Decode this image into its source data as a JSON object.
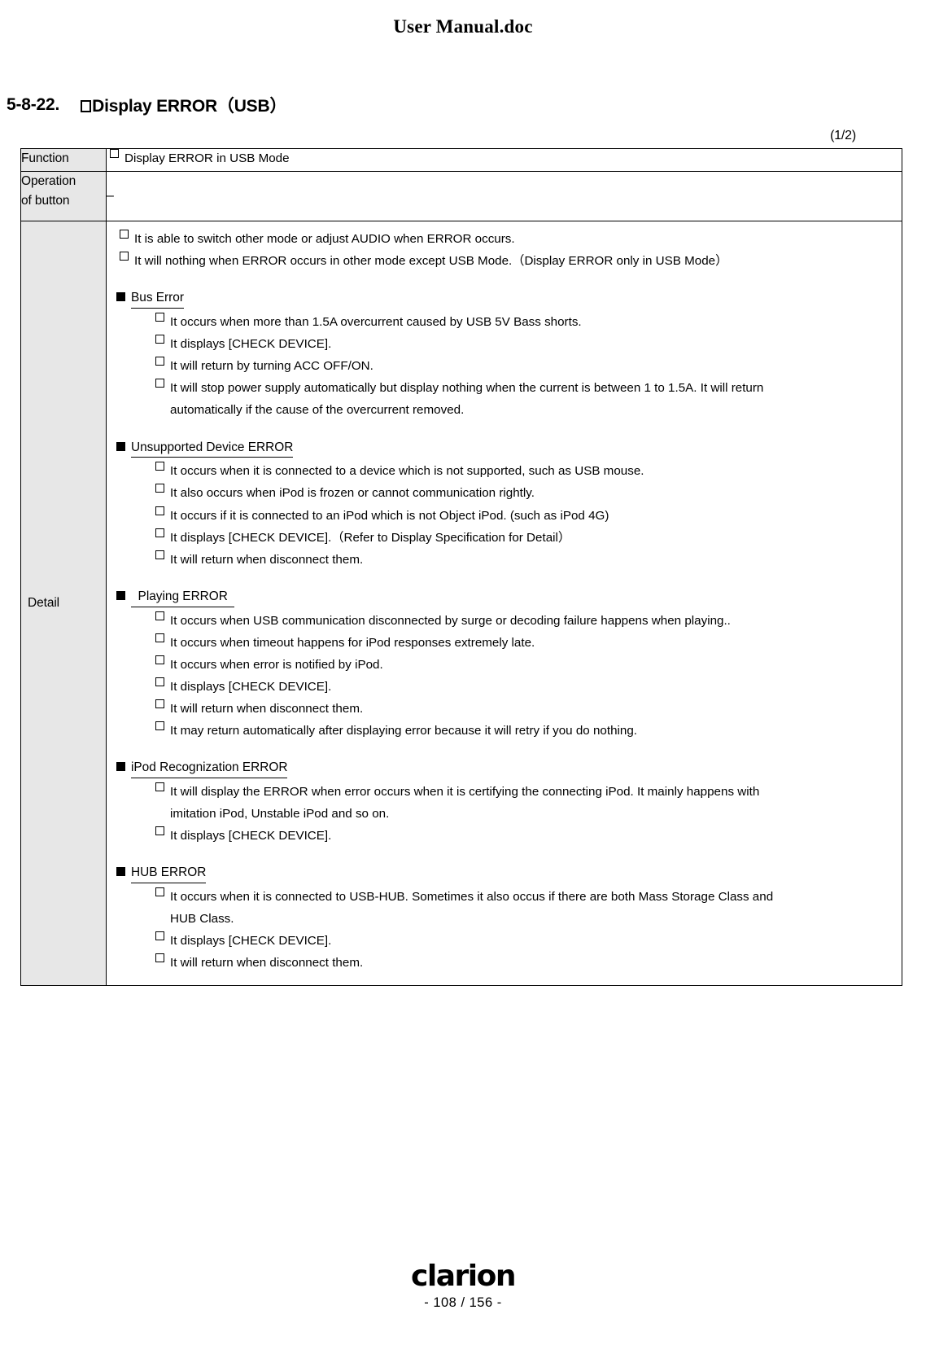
{
  "header": {
    "doc_title": "User Manual.doc"
  },
  "section": {
    "number": "5-8-22.",
    "title": "Display ERROR（USB）",
    "page_of": "(1/2)"
  },
  "table": {
    "rows": {
      "function": {
        "label": "Function",
        "value": "Display ERROR in USB Mode"
      },
      "operation": {
        "label_line1": "Operation",
        "label_line2": "of button",
        "value": "–"
      },
      "detail": {
        "label": "Detail",
        "intro": [
          "It is able to switch other mode or adjust AUDIO when ERROR occurs.",
          "It will nothing when ERROR occurs in other mode except USB Mode.（Display ERROR only in USB Mode）"
        ],
        "groups": [
          {
            "title": "Bus Error",
            "items": [
              {
                "text": "It occurs when more than 1.5A overcurrent caused by USB 5V Bass shorts.",
                "justify": false
              },
              {
                "text": "It displays [CHECK DEVICE].",
                "justify": false
              },
              {
                "text": "It will return by turning ACC OFF/ON.",
                "justify": false
              },
              {
                "text": "It will stop power supply automatically but display nothing when the current is between 1 to 1.5A. It will return",
                "justify": true,
                "continuation": "automatically if the cause of the overcurrent removed."
              }
            ]
          },
          {
            "title": "Unsupported Device ERROR",
            "items": [
              {
                "text": "It occurs when it is connected to a device which is not supported, such as USB mouse.",
                "justify": false
              },
              {
                "text": "It also occurs when iPod is frozen or cannot communication rightly.",
                "justify": false
              },
              {
                "text": "It occurs if it is connected to an iPod which is not Object iPod. (such as iPod 4G)",
                "justify": false
              },
              {
                "text": "It displays [CHECK DEVICE].（Refer to Display Specification for Detail）",
                "justify": false
              },
              {
                "text": "It will return when disconnect them.",
                "justify": false
              }
            ]
          },
          {
            "title": "  Playing ERROR  ",
            "items": [
              {
                "text": "It occurs when USB communication disconnected by surge or decoding failure happens when playing..",
                "justify": false
              },
              {
                "text": "It occurs when timeout happens for iPod responses extremely late.",
                "justify": false
              },
              {
                "text": "It occurs when error is notified by iPod.",
                "justify": false
              },
              {
                "text": "It displays [CHECK DEVICE].",
                "justify": false
              },
              {
                "text": "It will return when disconnect them.",
                "justify": false
              },
              {
                "text": "It may return automatically after displaying error because it will retry if you do nothing.",
                "justify": false
              }
            ]
          },
          {
            "title": "iPod Recognization ERROR",
            "items": [
              {
                "text": "It will display the ERROR when error occurs when it is certifying the connecting iPod. It mainly happens with",
                "justify": true,
                "continuation": "imitation iPod, Unstable iPod and so on."
              },
              {
                "text": "It displays [CHECK DEVICE].",
                "justify": false
              }
            ]
          },
          {
            "title": "HUB ERROR",
            "items": [
              {
                "text": "It occurs when it is connected to USB-HUB. Sometimes it also occus if there are both Mass Storage Class and",
                "justify": true,
                "continuation": "HUB Class."
              },
              {
                "text": "It displays [CHECK DEVICE].",
                "justify": false
              },
              {
                "text": "It will return when disconnect them.",
                "justify": false
              }
            ]
          }
        ]
      }
    }
  },
  "footer": {
    "logo": "clarion",
    "page_number": "- 108 / 156 -"
  }
}
